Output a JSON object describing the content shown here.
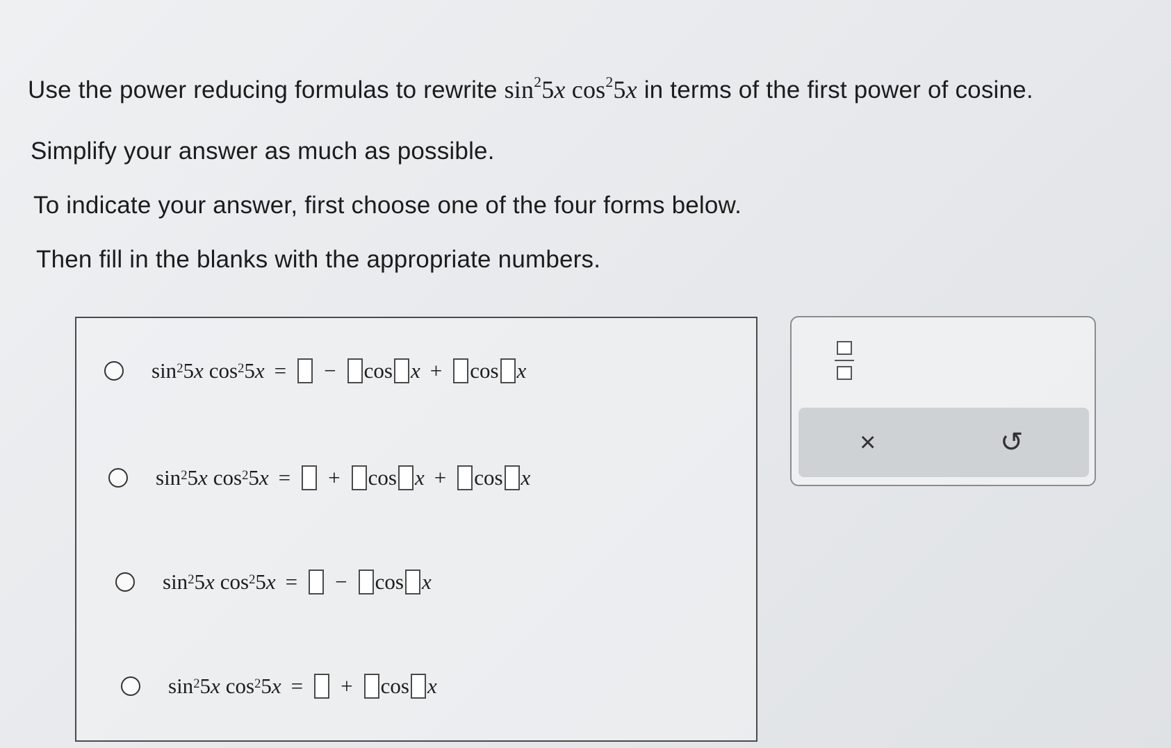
{
  "instructions": {
    "line1_before": "Use the power reducing formulas to rewrite ",
    "line1_expr": {
      "f1": "sin",
      "p1": "2",
      "a1": "5",
      "v1": "x",
      "f2": "cos",
      "p2": "2",
      "a2": "5",
      "v2": "x"
    },
    "line1_after": " in terms of the first power of cosine.",
    "line2": "Simplify your answer as much as possible.",
    "line3": "To indicate your answer, first choose one of the four forms below.",
    "line4": "Then fill in the blanks with the appropriate numbers."
  },
  "lhs": {
    "sin": "sin",
    "pow": "2",
    "arg": "5",
    "var": "x",
    "cos": "cos",
    "eq": "="
  },
  "symbols": {
    "minus": "−",
    "plus": "+",
    "cos": "cos",
    "x": "x"
  },
  "tools": {
    "clear": "×",
    "undo": "↺"
  }
}
